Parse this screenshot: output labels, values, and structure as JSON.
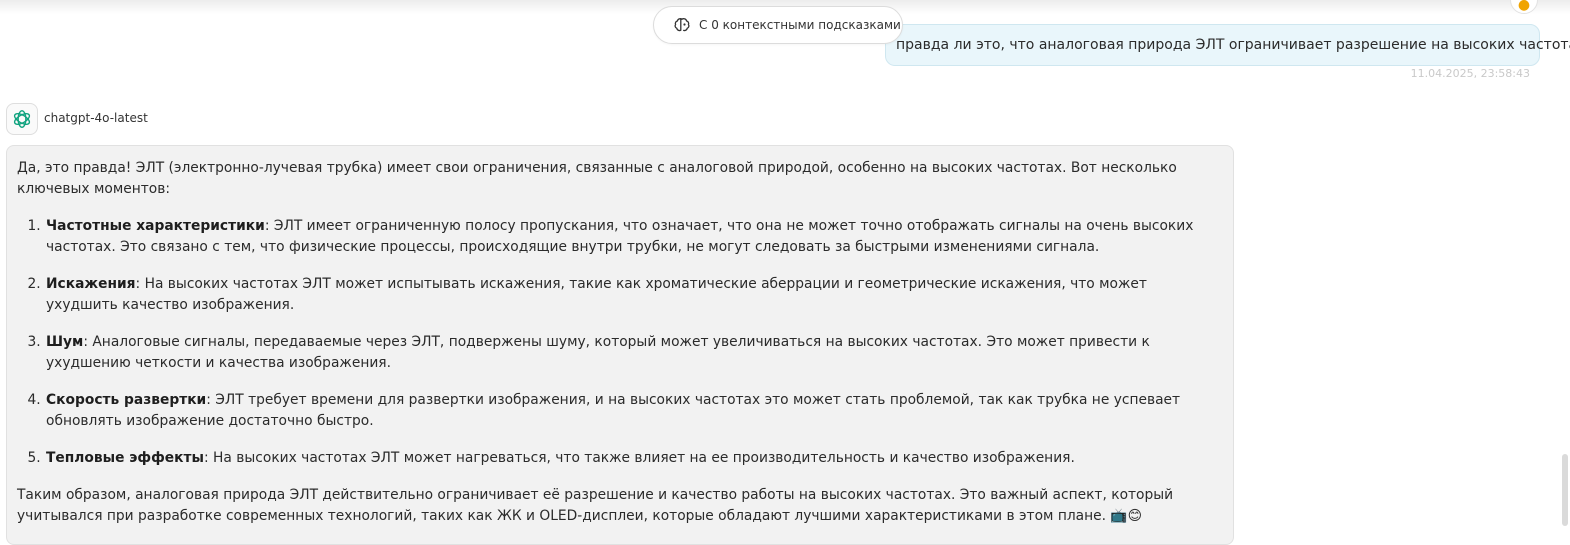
{
  "context_pill": {
    "label": "С 0 контекстными подсказками",
    "icon": "brain-icon"
  },
  "user_message": {
    "text": "правда ли это, что аналоговая природа ЭЛТ ограничивает разрешение на высоких частотах?",
    "timestamp": "11.04.2025, 23:58:43"
  },
  "assistant": {
    "model_name": "chatgpt-4o-latest",
    "logo_icon": "openai-logo-icon",
    "intro": "Да, это правда! ЭЛТ (электронно-лучевая трубка) имеет свои ограничения, связанные с аналоговой природой, особенно на высоких частотах. Вот несколько ключевых моментов:",
    "items": [
      {
        "term": "Частотные характеристики",
        "text": ": ЭЛТ имеет ограниченную полосу пропускания, что означает, что она не может точно отображать сигналы на очень высоких частотах. Это связано с тем, что физические процессы, происходящие внутри трубки, не могут следовать за быстрыми изменениями сигнала."
      },
      {
        "term": "Искажения",
        "text": ": На высоких частотах ЭЛТ может испытывать искажения, такие как хроматические аберрации и геометрические искажения, что может ухудшить качество изображения."
      },
      {
        "term": "Шум",
        "text": ": Аналоговые сигналы, передаваемые через ЭЛТ, подвержены шуму, который может увеличиваться на высоких частотах. Это может привести к ухудшению четкости и качества изображения."
      },
      {
        "term": "Скорость развертки",
        "text": ": ЭЛТ требует времени для развертки изображения, и на высоких частотах это может стать проблемой, так как трубка не успевает обновлять изображение достаточно быстро."
      },
      {
        "term": "Тепловые эффекты",
        "text": ": На высоких частотах ЭЛТ может нагреваться, что также влияет на ее производительность и качество изображения."
      }
    ],
    "conclusion": "Таким образом, аналоговая природа ЭЛТ действительно ограничивает её разрешение и качество работы на высоких частотах. Это важный аспект, который учитывался при разработке современных технологий, таких как ЖК и OLED-дисплеи, которые обладают лучшими характеристиками в этом плане. 📺😊"
  },
  "colors": {
    "user_bubble_bg": "#e9f6fb",
    "answer_bg": "#f2f2f2",
    "logo_color": "#10a37f"
  }
}
